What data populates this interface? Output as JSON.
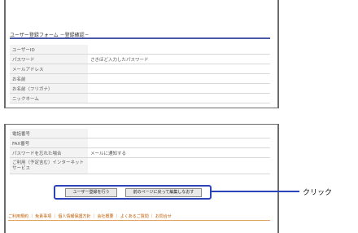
{
  "page_title": "ユーザー登録フォーム －登録確認－",
  "form_top": {
    "rows": [
      {
        "label": "ユーザーID",
        "value": ""
      },
      {
        "label": "パスワード",
        "value": "さきほど入力したパスワード"
      },
      {
        "label": "メールアドレス",
        "value": ""
      },
      {
        "label": "お名前",
        "value": ""
      },
      {
        "label": "お名前（フリガナ）",
        "value": ""
      },
      {
        "label": "ニックネーム",
        "value": ""
      }
    ]
  },
  "form_bottom": {
    "rows": [
      {
        "label": "電話番号",
        "value": ""
      },
      {
        "label": "FAX番号",
        "value": ""
      },
      {
        "label": "パスワードを忘れた場合",
        "value": "メールに通知する"
      },
      {
        "label": "ご利用（予定含む）インターネットサービス",
        "value": ""
      }
    ]
  },
  "buttons": {
    "register": "ユーザー登録を行う",
    "back": "前のページに戻って編集しなおす"
  },
  "callout": "クリック",
  "footer": "ご利用規約 ｜ 免責事項 ｜ 個人情報保護方針 ｜ 会社概要 ｜ よくあるご質問 ｜ お問合せ",
  "colors": {
    "accent": "#2b44b8",
    "footer_link": "#c05a00",
    "title_rule": "#4a59a5"
  }
}
